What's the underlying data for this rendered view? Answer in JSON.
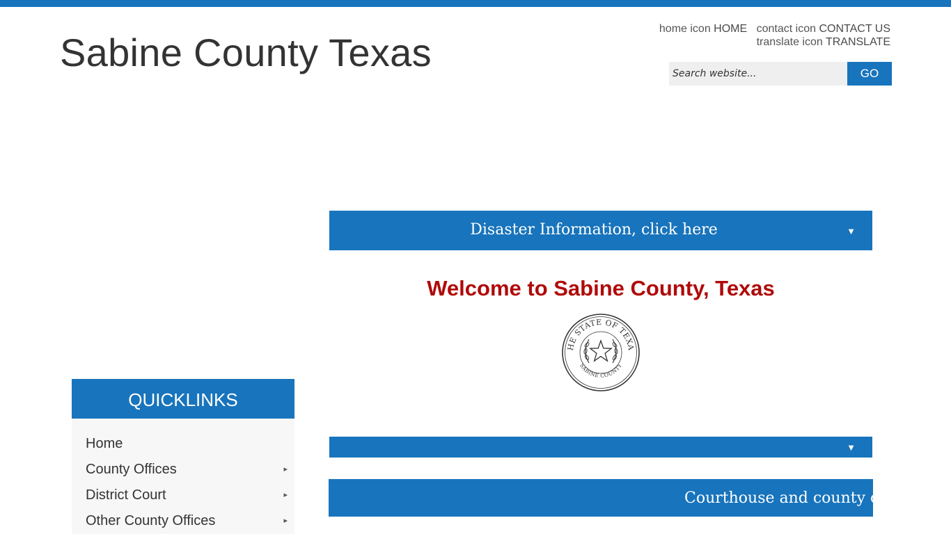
{
  "header": {
    "site_title": "Sabine County Texas"
  },
  "utility_nav": {
    "home": {
      "icon_alt": "home icon",
      "label": "HOME"
    },
    "contact": {
      "icon_alt": "contact icon",
      "label": "CONTACT US"
    },
    "translate": {
      "icon_alt": "translate icon",
      "label": "TRANSLATE"
    }
  },
  "search": {
    "placeholder": "Search website...",
    "button_label": "GO"
  },
  "disaster_accordion": {
    "label": "Disaster Information, click here",
    "caret": "▼"
  },
  "second_accordion": {
    "caret": "▼"
  },
  "welcome": {
    "heading": "Welcome to Sabine County, Texas"
  },
  "seal": {
    "top_text": "THE STATE OF TEXAS",
    "bottom_text": "SABINE COUNTY"
  },
  "banner": {
    "text": "Courthouse and county offices"
  },
  "quicklinks": {
    "title": "QUICKLINKS",
    "items": [
      {
        "label": "Home",
        "has_submenu": false
      },
      {
        "label": "County Offices",
        "has_submenu": true,
        "arrow": "▸"
      },
      {
        "label": "District Court",
        "has_submenu": true,
        "arrow": "▸"
      },
      {
        "label": "Other County Offices",
        "has_submenu": true,
        "arrow": "▸"
      }
    ]
  },
  "colors": {
    "brand_blue": "#1874bc",
    "welcome_red": "#b00a0a",
    "text_dark": "#333333"
  }
}
